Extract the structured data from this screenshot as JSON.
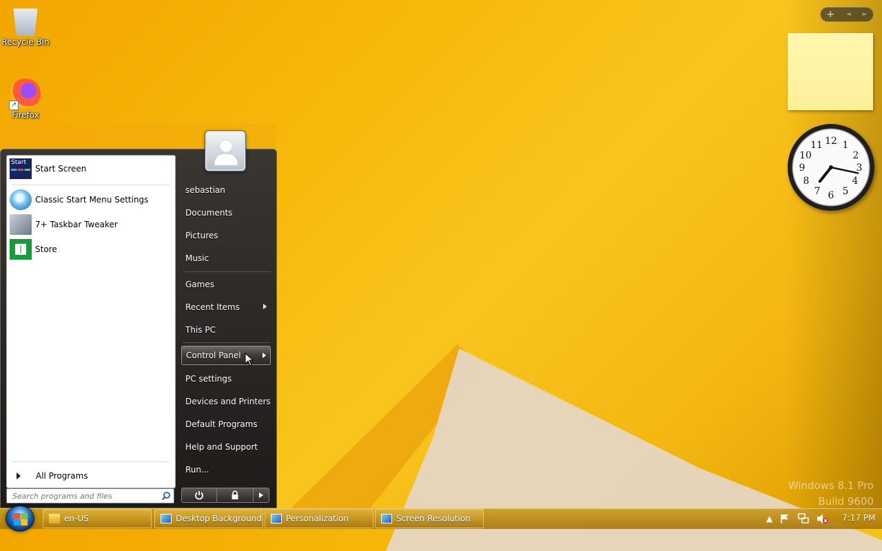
{
  "desktop": {
    "icons": [
      {
        "label": "Recycle Bin",
        "icon": "recycle-bin-icon"
      },
      {
        "label": "Firefox",
        "icon": "firefox-icon"
      }
    ],
    "watermark_line1": "Windows 8.1 Pro",
    "watermark_line2": "Build 9600"
  },
  "gadgets": {
    "toolbar": {
      "add": "+",
      "prev": "◄",
      "next": "►"
    },
    "clock": {
      "hour": 7,
      "minute": 17
    }
  },
  "start_menu": {
    "pinned": [
      {
        "label": "Start Screen",
        "icon": "start-screen-icon",
        "icon_text": "Start"
      },
      {
        "label": "Classic Start Menu Settings",
        "icon": "classic-shell-icon"
      },
      {
        "label": "7+ Taskbar Tweaker",
        "icon": "taskbar-tweaker-icon"
      },
      {
        "label": "Store",
        "icon": "store-icon"
      }
    ],
    "all_programs": "All Programs",
    "search_placeholder": "Search programs and files",
    "right_items": [
      {
        "label": "sebastian"
      },
      {
        "label": "Documents"
      },
      {
        "label": "Pictures"
      },
      {
        "label": "Music"
      },
      {
        "label": "Games"
      },
      {
        "label": "Recent Items",
        "submenu": true
      },
      {
        "label": "This PC"
      },
      {
        "label": "Control Panel",
        "submenu": true,
        "highlighted": true
      },
      {
        "label": "PC settings"
      },
      {
        "label": "Devices and Printers"
      },
      {
        "label": "Default Programs"
      },
      {
        "label": "Help and Support"
      },
      {
        "label": "Run..."
      }
    ]
  },
  "taskbar": {
    "buttons": [
      {
        "label": "en-US",
        "icon": "folder-icon"
      },
      {
        "label": "Desktop Background",
        "icon": "control-panel-icon"
      },
      {
        "label": "Personalization",
        "icon": "control-panel-icon"
      },
      {
        "label": "Screen Resolution",
        "icon": "control-panel-icon"
      }
    ],
    "time": "7:17 PM"
  }
}
